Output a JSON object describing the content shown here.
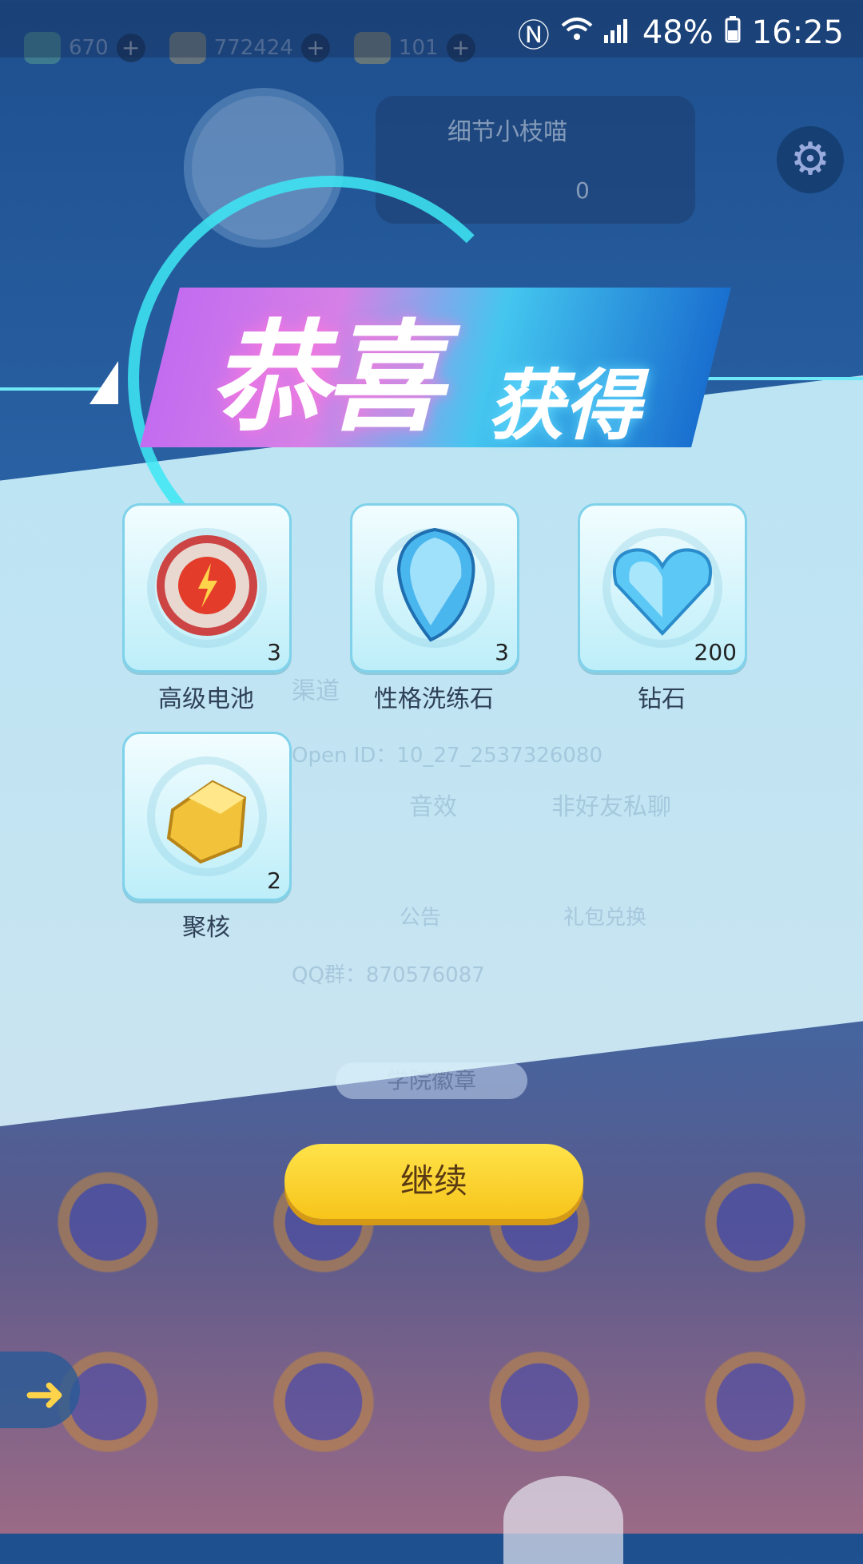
{
  "status_bar": {
    "battery": "48%",
    "time": "16:25"
  },
  "hud": {
    "resource_1": "670",
    "resource_2": "772424",
    "resource_3": "101"
  },
  "profile": {
    "name": "细节小枝喵",
    "score": "0"
  },
  "background_settings": {
    "channel_label": "渠道",
    "open_id": "Open ID：10_27_2537326080",
    "sound_effect_label": "音效",
    "non_friend_chat_label": "非好友私聊",
    "announcement_label": "公告",
    "gift_exchange_label": "礼包兑换",
    "qq_group_label": "QQ群：870576087",
    "academy_badge_label": "学院徽章"
  },
  "dialog": {
    "title_main": "恭喜",
    "title_sub": "获得",
    "continue_label": "继续"
  },
  "rewards": [
    {
      "name": "高级电池",
      "count": "3",
      "icon": "battery-gear-icon"
    },
    {
      "name": "性格洗练石",
      "count": "3",
      "icon": "blue-teardrop-gem-icon"
    },
    {
      "name": "钻石",
      "count": "200",
      "icon": "heart-diamond-icon"
    },
    {
      "name": "聚核",
      "count": "2",
      "icon": "gold-crystal-icon"
    }
  ],
  "colors": {
    "accent_cyan": "#3ee8f5",
    "button_yellow": "#f7c41a",
    "panel_bg": "#d0f2fb"
  }
}
